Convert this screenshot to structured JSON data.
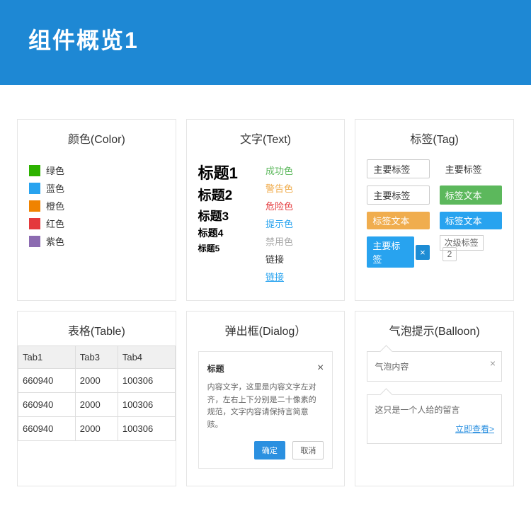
{
  "banner": {
    "title": "组件概览1"
  },
  "colorCard": {
    "title": "颜色(Color)",
    "items": [
      {
        "hex": "#2db200",
        "label": "绿色"
      },
      {
        "hex": "#28a3ef",
        "label": "蓝色"
      },
      {
        "hex": "#f08300",
        "label": "橙色"
      },
      {
        "hex": "#e4393c",
        "label": "红色"
      },
      {
        "hex": "#8c6bb1",
        "label": "紫色"
      }
    ]
  },
  "textCard": {
    "title": "文字(Text)",
    "headings": {
      "h1": "标题1",
      "h2": "标题2",
      "h3": "标题3",
      "h4": "标题4",
      "h5": "标题5"
    },
    "states": {
      "success": {
        "label": "成功色",
        "color": "#5cb85c"
      },
      "warning": {
        "label": "警告色",
        "color": "#f0ad4e"
      },
      "danger": {
        "label": "危险色",
        "color": "#e4393c"
      },
      "info": {
        "label": "提示色",
        "color": "#28a3ef"
      },
      "disabled": {
        "label": "禁用色",
        "color": "#aaaaaa"
      },
      "link1": {
        "label": "链接",
        "color": "#333333"
      },
      "link2": {
        "label": "链接",
        "color": "#28a3ef"
      }
    }
  },
  "tagCard": {
    "title": "标签(Tag)",
    "tags": {
      "t1": "主要标签",
      "t2": "主要标签",
      "t3": "主要标签",
      "t4": "标签文本",
      "t5": "标签文本",
      "t6": "标签文本",
      "t7": "主要标签",
      "t8": "次级标签",
      "badge": "2"
    }
  },
  "tableCard": {
    "title": "表格(Table)",
    "headers": [
      "Tab1",
      "Tab3",
      "Tab4"
    ],
    "rows": [
      [
        "660940",
        "2000",
        "100306"
      ],
      [
        "660940",
        "2000",
        "100306"
      ],
      [
        "660940",
        "2000",
        "100306"
      ]
    ]
  },
  "dialogCard": {
    "title": "弹出框(Dialog）",
    "head": "标题",
    "body": "内容文字，这里是内容文字左对齐，左右上下分别是二十像素的规范，文字内容请保持言简意赅。",
    "ok": "确定",
    "cancel": "取消"
  },
  "balloonCard": {
    "title": "气泡提示(Balloon)",
    "b1": "气泡内容",
    "b2": "这只是一个人给的留言",
    "link": "立即查看>"
  }
}
